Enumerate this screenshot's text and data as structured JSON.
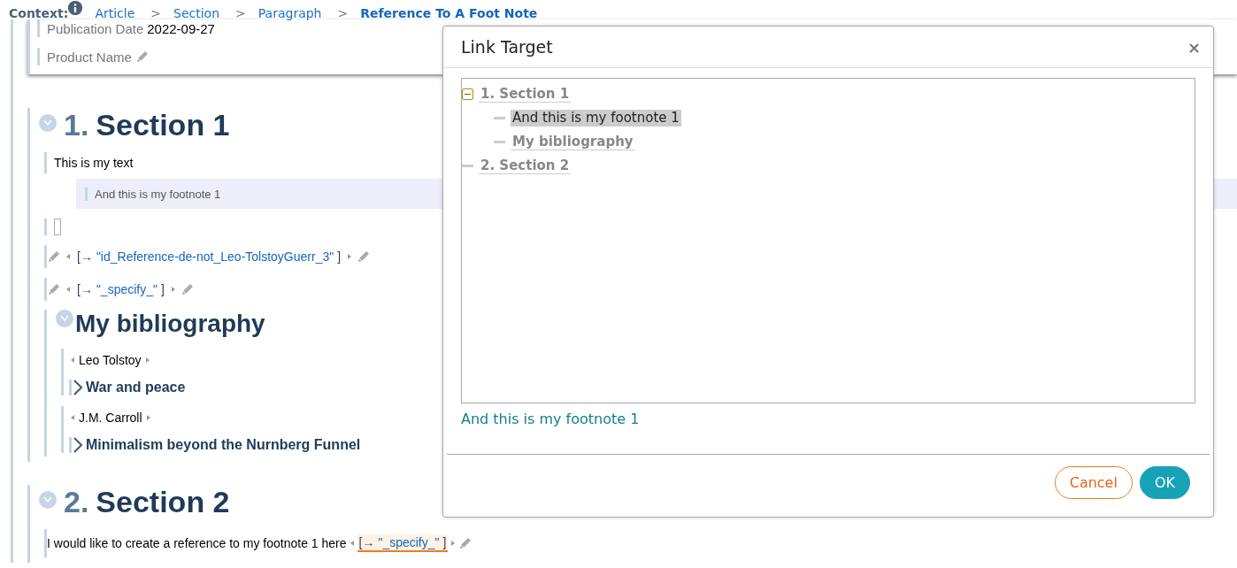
{
  "context": {
    "label": "Context:",
    "crumbs": [
      {
        "label": "Article",
        "current": false
      },
      {
        "label": "Section",
        "current": false
      },
      {
        "label": "Paragraph",
        "current": false
      },
      {
        "label": "Reference To A Foot Note",
        "current": true
      }
    ],
    "separator": ">"
  },
  "header_fields": [
    {
      "label": "Publication Date",
      "value": "2022-09-27",
      "editable": false
    },
    {
      "label": "Product Name",
      "editable": true
    }
  ],
  "sections": [
    {
      "number": "1.",
      "title": "Section 1",
      "blocks": [
        {
          "kind": "paragraph",
          "text": "This is my text"
        },
        {
          "kind": "footnote",
          "text": "And this is my footnote 1"
        },
        {
          "kind": "empty"
        },
        {
          "kind": "reference",
          "prefix": "[→ ",
          "target": "\"id_Reference-de-not_Leo-TolstoyGuerr_3\"",
          "suffix": "]",
          "selected": false
        },
        {
          "kind": "reference",
          "prefix": "[→ ",
          "target": "\"_specify_\"",
          "suffix": "]",
          "selected": false
        },
        {
          "kind": "subsection",
          "title": "My bibliography",
          "entries": [
            {
              "author": "Leo Tolstoy",
              "title": "War and peace"
            },
            {
              "author": "J.M. Carroll",
              "title": "Minimalism beyond the Nurnberg Funnel"
            }
          ]
        }
      ]
    },
    {
      "number": "2.",
      "title": "Section 2",
      "blocks": [
        {
          "kind": "paragraph",
          "text": "I would like to create a reference to my footnote 1 here",
          "reference": {
            "prefix": "[→ ",
            "target": "\"_specify_\"",
            "suffix": "]",
            "selected": true
          }
        }
      ]
    }
  ],
  "dialog": {
    "title": "Link Target",
    "close": "×",
    "tree": [
      {
        "label": "1. Section 1",
        "selected": false,
        "expanded": true,
        "children": [
          {
            "label": "And this is my footnote 1",
            "selected": true
          },
          {
            "label": "My bibliography",
            "selected": false
          }
        ]
      },
      {
        "label": "2. Section 2",
        "selected": false
      }
    ],
    "preview": "And this is my footnote 1",
    "buttons": [
      {
        "label": "Cancel",
        "kind": "secondary"
      },
      {
        "label": "OK",
        "kind": "primary"
      }
    ]
  }
}
